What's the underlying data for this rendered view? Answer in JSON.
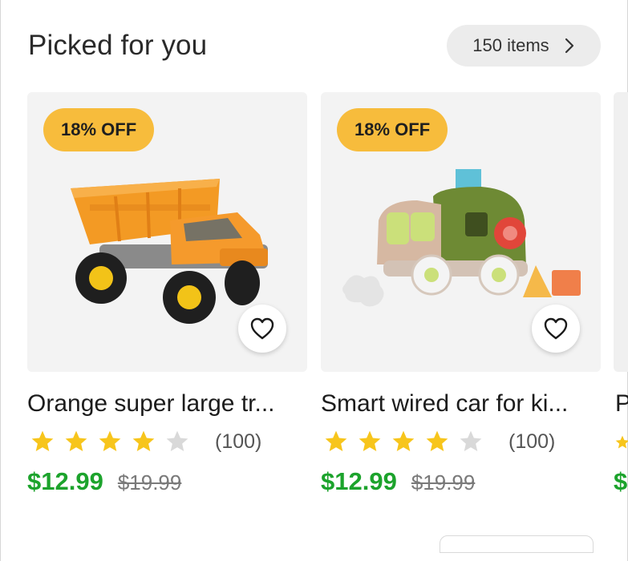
{
  "section": {
    "title": "Picked for you",
    "count_label": "150 items"
  },
  "products": [
    {
      "badge": "18% OFF",
      "name": "Orange super large tr...",
      "rating_stars": 4,
      "rating_count": "(100)",
      "price": "$12.99",
      "original_price": "$19.99"
    },
    {
      "badge": "18% OFF",
      "name": "Smart wired car for ki...",
      "rating_stars": 4,
      "rating_count": "(100)",
      "price": "$12.99",
      "original_price": "$19.99"
    }
  ],
  "peek_card": {
    "name_initial": "P",
    "price_initial": "$"
  },
  "colors": {
    "badge": "#f7bc3c",
    "price": "#1ca32c",
    "star_filled": "#f7c51c",
    "star_empty": "#d9d9d9"
  },
  "icons": {
    "chevron": "chevron-right-icon",
    "favorite": "heart-outline-icon",
    "star": "star-icon"
  }
}
